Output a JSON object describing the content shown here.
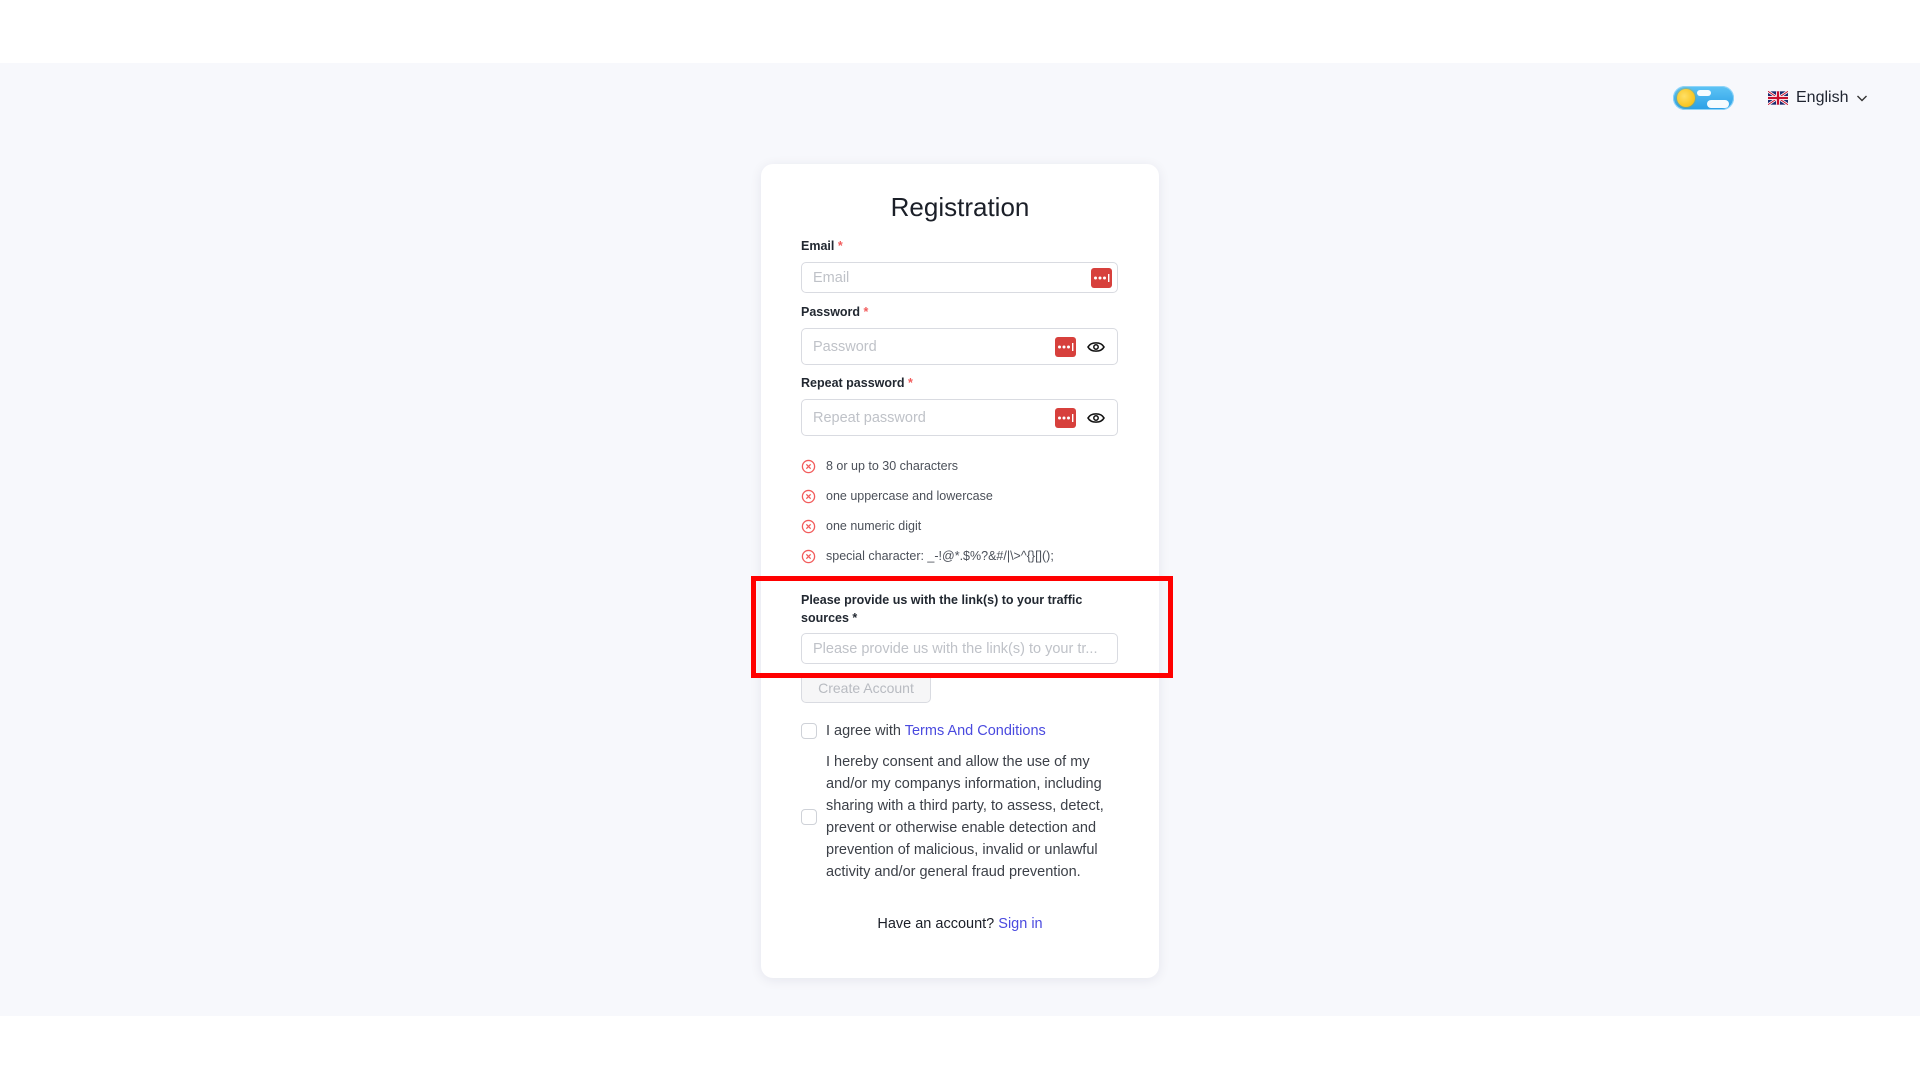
{
  "header": {
    "theme_toggle": {
      "mode": "light",
      "icon": "sun-cloud-icon"
    },
    "language": {
      "selected": "English",
      "flag": "uk-flag-icon"
    }
  },
  "form": {
    "title": "Registration",
    "email": {
      "label": "Email",
      "required_mark": "*",
      "placeholder": "Email",
      "value": ""
    },
    "password": {
      "label": "Password",
      "required_mark": "*",
      "placeholder": "Password",
      "value": ""
    },
    "repeat_password": {
      "label": "Repeat password",
      "required_mark": "*",
      "placeholder": "Repeat password",
      "value": ""
    },
    "password_rules": [
      {
        "text": "8 or up to 30 characters",
        "status": "invalid"
      },
      {
        "text": "one uppercase and lowercase",
        "status": "invalid"
      },
      {
        "text": "one numeric digit",
        "status": "invalid"
      },
      {
        "text": "special character: _-!@*.$%?&#/|\\>^{}[]();",
        "status": "invalid"
      }
    ],
    "traffic_sources": {
      "label": "Please provide us with the link(s) to your traffic sources *",
      "placeholder": "Please provide us with the link(s) to your tr...",
      "value": ""
    },
    "create_button": "Create Account",
    "terms": {
      "prefix": "I agree with ",
      "link": "Terms And Conditions",
      "checked": false
    },
    "consent": {
      "text": "I hereby consent and allow the use of my and/or my companys information, including sharing with a third party, to assess, detect, prevent or otherwise enable detection and prevention of malicious, invalid or unlawful activity and/or general fraud prevention.",
      "checked": false
    },
    "signin": {
      "prompt": "Have an account? ",
      "link": "Sign in"
    }
  },
  "colors": {
    "accent_link": "#4a4adf",
    "error": "#f25c5c",
    "password_manager": "#d7403c",
    "highlight": "#ff0000"
  }
}
